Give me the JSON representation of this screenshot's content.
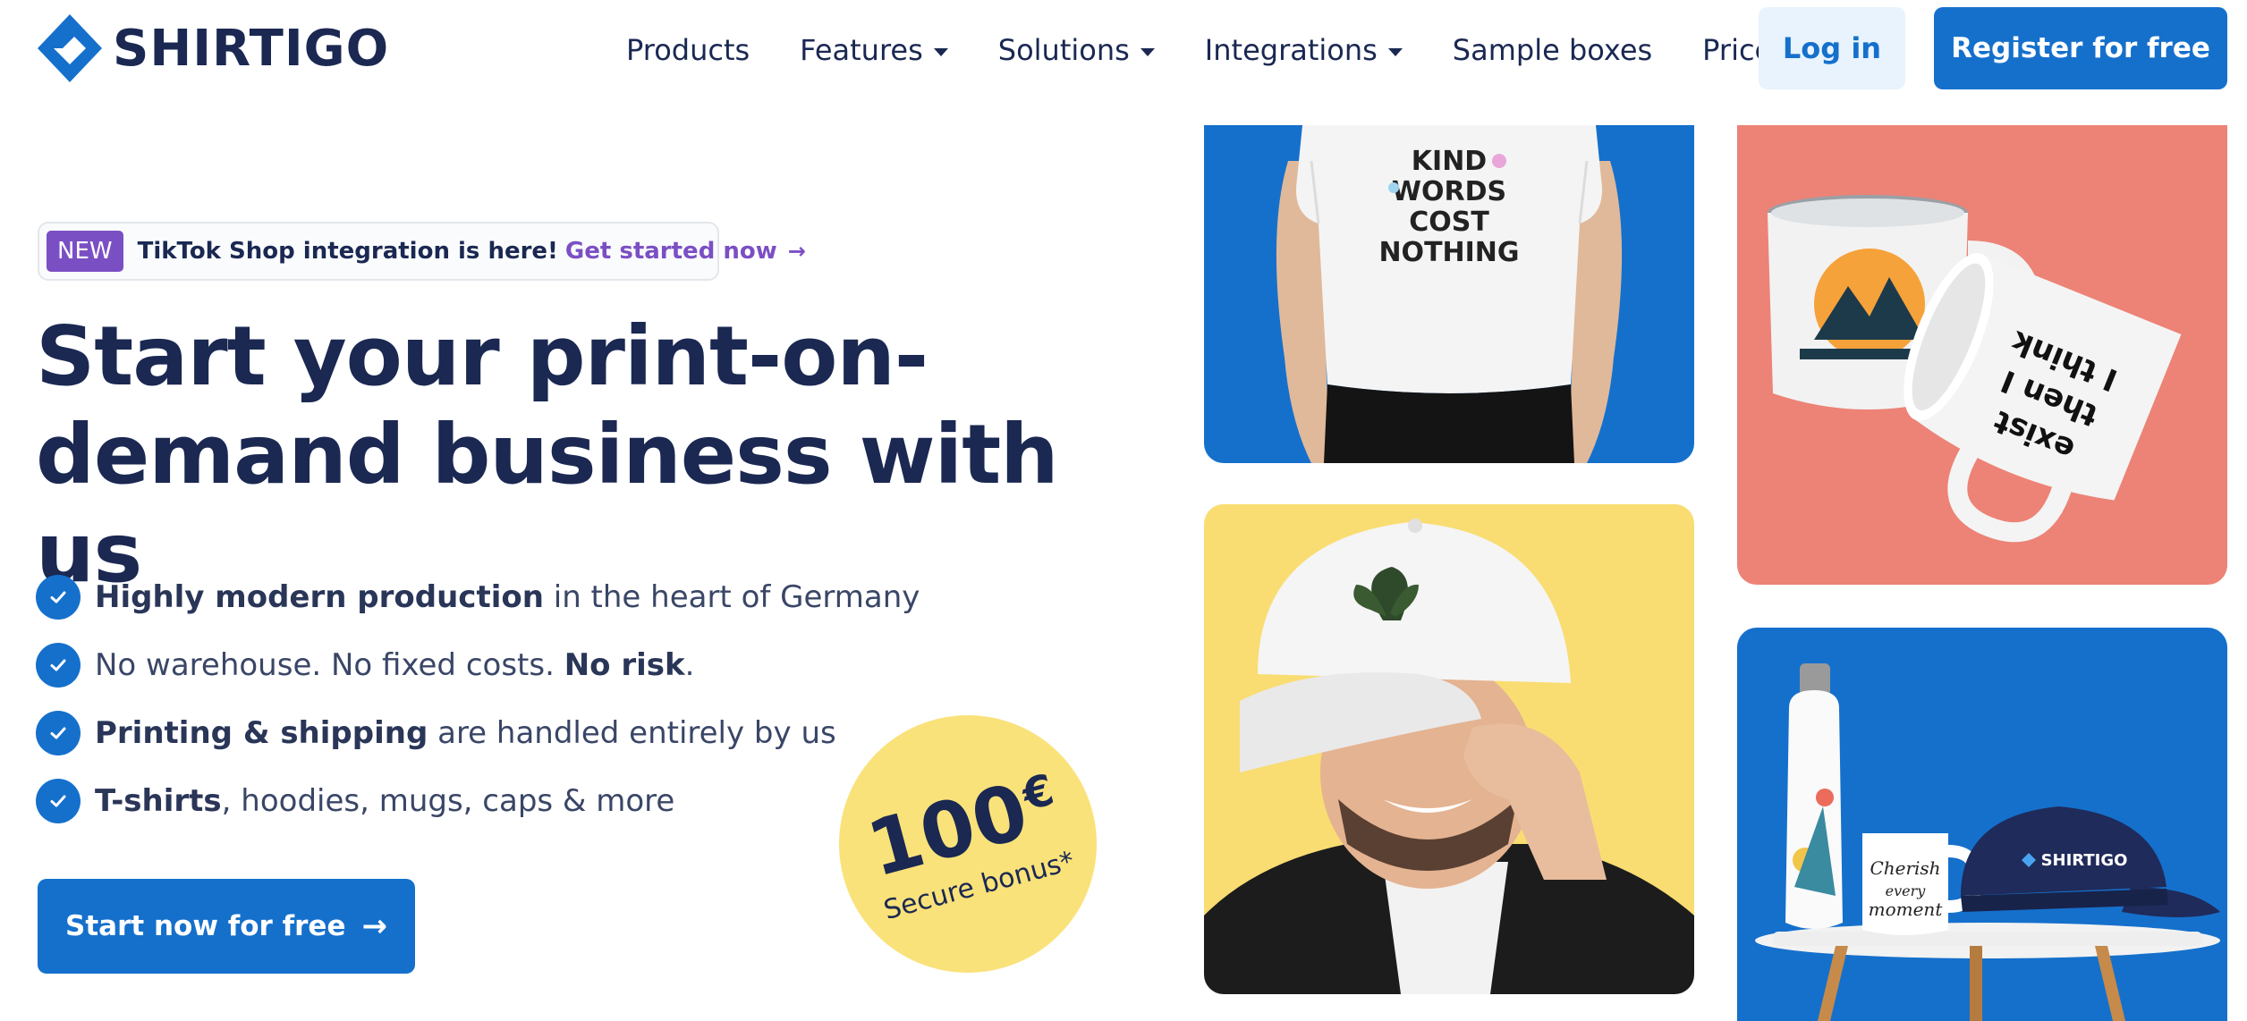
{
  "brand": {
    "name": "SHIRTIGO",
    "logo_icon": "shirtigo-diamond-logo",
    "color_primary": "#1570cc",
    "color_dark": "#1a2852"
  },
  "nav": {
    "items": [
      {
        "label": "Products",
        "dropdown": false
      },
      {
        "label": "Features",
        "dropdown": true
      },
      {
        "label": "Solutions",
        "dropdown": true
      },
      {
        "label": "Integrations",
        "dropdown": true
      },
      {
        "label": "Sample boxes",
        "dropdown": false
      },
      {
        "label": "Prices",
        "dropdown": false
      }
    ],
    "login_label": "Log in",
    "register_label": "Register for free"
  },
  "announcement": {
    "badge": "NEW",
    "text": "TikTok Shop integration is here!",
    "link": "Get started now",
    "badge_color": "#7b4fc4"
  },
  "hero": {
    "headline_line1": "Start your print-on-",
    "headline_line2": "demand business with us",
    "bullets": [
      {
        "bold_start": "Highly modern production",
        "rest": " in the heart of Germany"
      },
      {
        "plain": "No warehouse. No fixed costs. ",
        "bold_end": "No risk",
        "tail": "."
      },
      {
        "bold_start": "Printing & shipping",
        "rest": " are handled entirely by us"
      },
      {
        "bold_start": "T-shirts",
        "rest": ", hoodies, mugs, caps & more"
      }
    ],
    "cta_label": "Start now for free"
  },
  "bonus": {
    "amount": "100",
    "currency": "€",
    "label": "Secure bonus*",
    "color": "#fae27a"
  },
  "tiles": [
    {
      "name": "tshirt-model-image",
      "bg": "#1570cc",
      "shirt_print": "KIND WORDS COST NOTHING"
    },
    {
      "name": "mugs-image",
      "bg": "#ec8376",
      "mug_print": "I think therefore I exist"
    },
    {
      "name": "cap-model-image",
      "bg": "#f9dd72"
    },
    {
      "name": "bottle-mug-cap-image",
      "bg": "#1570cc",
      "mug_print": "Cherish every moment",
      "cap_print": "SHIRTIGO"
    }
  ]
}
